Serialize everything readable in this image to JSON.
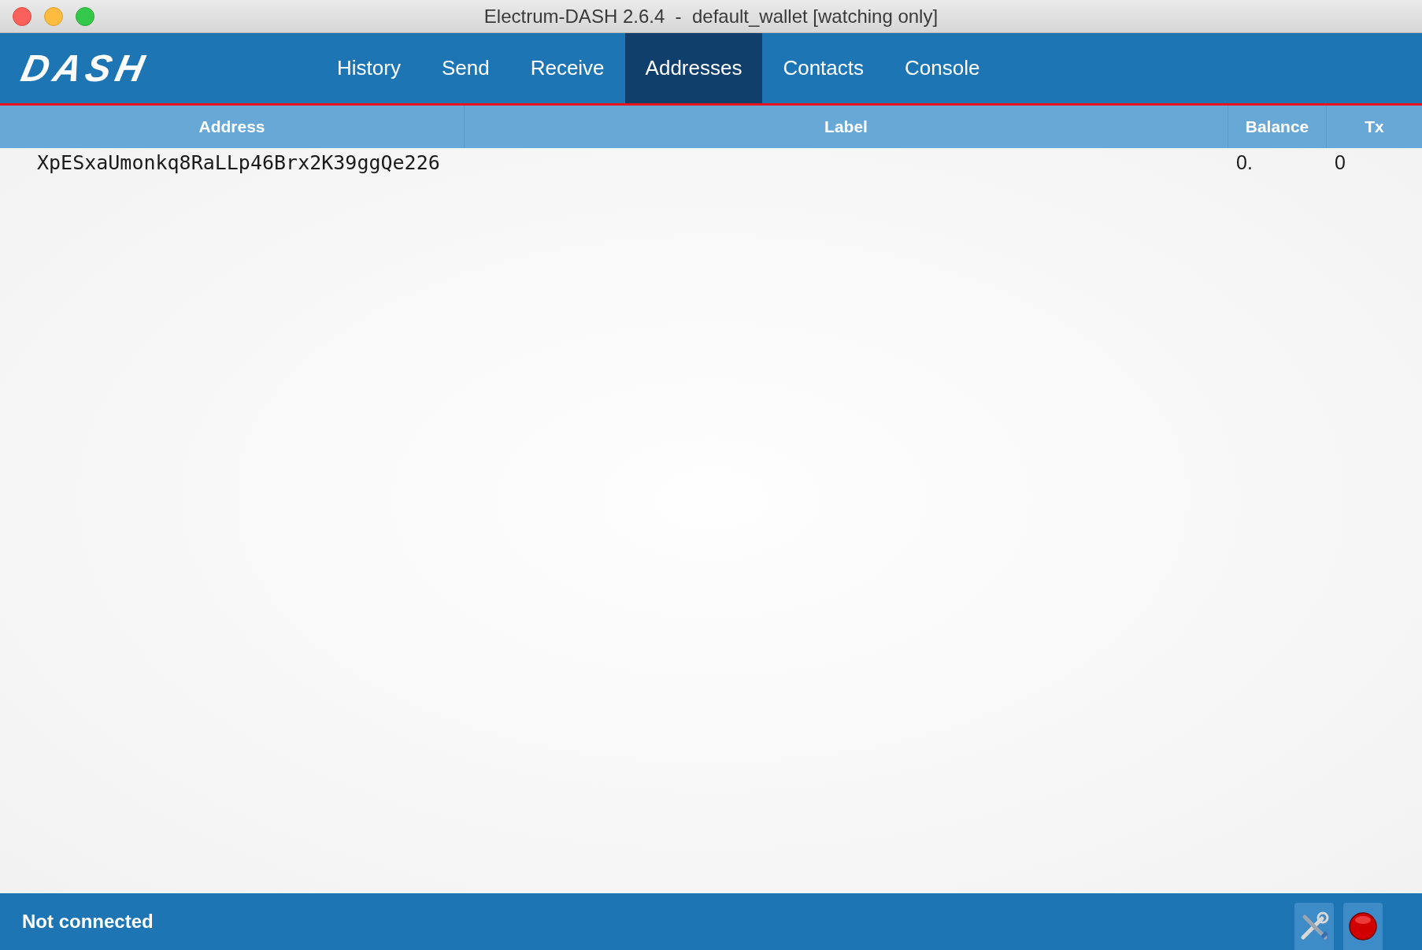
{
  "window": {
    "title": "Electrum-DASH 2.6.4  -  default_wallet [watching only]"
  },
  "logo": {
    "text": "DASH"
  },
  "tabs": [
    {
      "label": "History",
      "selected": false
    },
    {
      "label": "Send",
      "selected": false
    },
    {
      "label": "Receive",
      "selected": false
    },
    {
      "label": "Addresses",
      "selected": true
    },
    {
      "label": "Contacts",
      "selected": false
    },
    {
      "label": "Console",
      "selected": false
    }
  ],
  "table": {
    "columns": [
      "Address",
      "Label",
      "Balance",
      "Tx"
    ],
    "rows": [
      {
        "address": "XpESxaUmonkq8RaLLp46Brx2K39ggQe226",
        "label": "",
        "balance": "0.",
        "tx": "0"
      }
    ]
  },
  "status_bar": {
    "text": "Not connected"
  }
}
